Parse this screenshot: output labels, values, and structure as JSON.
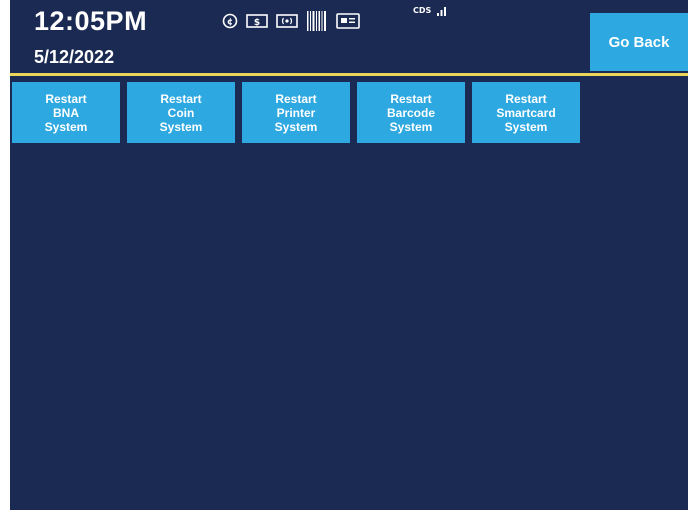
{
  "header": {
    "time": "12:05PM",
    "date": "5/12/2022",
    "cds_label": "CDS",
    "go_back_label": "Go Back",
    "status_icons": [
      "coin-icon",
      "cash-icon",
      "contactless-icon",
      "barcode-icon",
      "card-reader-icon",
      "signal-icon"
    ]
  },
  "buttons": [
    {
      "line1": "Restart",
      "line2": "BNA",
      "line3": "System"
    },
    {
      "line1": "Restart",
      "line2": "Coin",
      "line3": "System"
    },
    {
      "line1": "Restart",
      "line2": "Printer",
      "line3": "System"
    },
    {
      "line1": "Restart",
      "line2": "Barcode",
      "line3": "System"
    },
    {
      "line1": "Restart",
      "line2": "Smartcard",
      "line3": "System"
    }
  ],
  "colors": {
    "background": "#1b2a52",
    "button": "#2ea8e0",
    "divider": "#e8d55a",
    "text": "#ffffff"
  }
}
